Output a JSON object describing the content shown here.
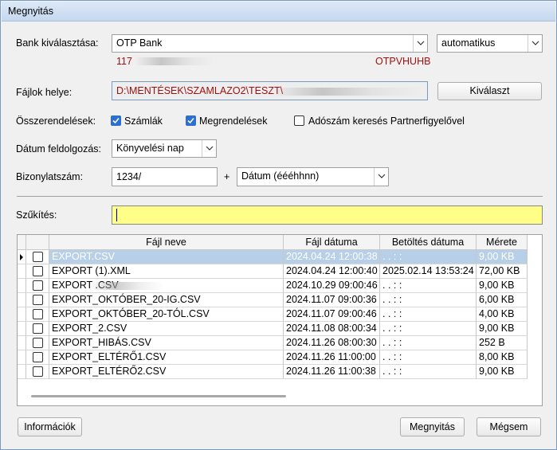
{
  "window": {
    "title": "Megnyitás"
  },
  "bank": {
    "label": "Bank kiválasztása:",
    "selected": "OTP Bank",
    "mode": "automatikus",
    "code": "117",
    "swift": "OTPVHUHB"
  },
  "files_location": {
    "label": "Fájlok helye:",
    "path": "D:\\MENTÉSEK\\SZAMLAZO2\\TESZT\\",
    "browse_button": "Kiválaszt"
  },
  "matching": {
    "label": "Összerendelések:",
    "options": [
      {
        "label": "Számlák",
        "checked": true
      },
      {
        "label": "Megrendelések",
        "checked": true
      },
      {
        "label": "Adószám keresés Partnerfigyelővel",
        "checked": false
      }
    ]
  },
  "date_processing": {
    "label": "Dátum feldolgozás:",
    "selected": "Könyvelési nap"
  },
  "voucher": {
    "label": "Bizonylatszám:",
    "prefix": "1234/",
    "plus": "+",
    "format": "Dátum (éééhhnn)"
  },
  "filter": {
    "label": "Szűkítés:",
    "value": ""
  },
  "table": {
    "columns": [
      "Fájl neve",
      "Fájl dátuma",
      "Betöltés dátuma",
      "Mérete"
    ],
    "rows": [
      {
        "name": "EXPORT.CSV",
        "file_date": "2024.04.24 12:00:38",
        "load_date": ".  .      :  :",
        "size": "9,00 KB",
        "selected": true
      },
      {
        "name": "EXPORT (1).XML",
        "file_date": "2024.04.24 12:00:40",
        "load_date": "2025.02.14 13:53:24",
        "size": "72,00 KB",
        "selected": false
      },
      {
        "name": "EXPORT                    .CSV",
        "file_date": "2024.10.29 09:00:46",
        "load_date": ".  .      :  :",
        "size": "9,00 KB",
        "selected": false
      },
      {
        "name": "EXPORT_OKTÓBER_20-IG.CSV",
        "file_date": "2024.11.07 09:00:36",
        "load_date": ".  .      :  :",
        "size": "6,00 KB",
        "selected": false
      },
      {
        "name": "EXPORT_OKTÓBER_20-TÓL.CSV",
        "file_date": "2024.11.07 09:00:46",
        "load_date": ".  .      :  :",
        "size": "4,00 KB",
        "selected": false
      },
      {
        "name": "EXPORT_2.CSV",
        "file_date": "2024.11.08 08:00:34",
        "load_date": ".  .      :  :",
        "size": "9,00 KB",
        "selected": false
      },
      {
        "name": "EXPORT_HIBÁS.CSV",
        "file_date": "2024.11.26 08:00:30",
        "load_date": ".  .      :  :",
        "size": "252 B",
        "selected": false
      },
      {
        "name": "EXPORT_ELTÉRŐ1.CSV",
        "file_date": "2024.11.26 11:00:00",
        "load_date": ".  .      :  :",
        "size": "8,00 KB",
        "selected": false
      },
      {
        "name": "EXPORT_ELTÉRŐ2.CSV",
        "file_date": "2024.11.26 11:00:38",
        "load_date": ".  .      :  :",
        "size": "9,00 KB",
        "selected": false
      }
    ]
  },
  "buttons": {
    "info": "Információk",
    "open": "Megnyitás",
    "cancel": "Mégsem"
  }
}
